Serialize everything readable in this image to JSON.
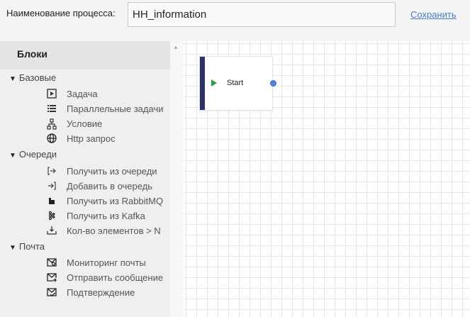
{
  "header": {
    "process_label": "Наименование процесса:",
    "process_name": "HH_information",
    "save_label": "Сохранить"
  },
  "sidebar": {
    "title": "Блоки",
    "groups": [
      {
        "label": "Базовые",
        "items": [
          {
            "label": "Задача",
            "icon": "play-box-icon"
          },
          {
            "label": "Параллельные задачи",
            "icon": "parallel-list-icon"
          },
          {
            "label": "Условие",
            "icon": "branch-icon"
          },
          {
            "label": "Http запрос",
            "icon": "globe-icon"
          }
        ]
      },
      {
        "label": "Очереди",
        "items": [
          {
            "label": "Получить из очереди",
            "icon": "arrow-out-icon"
          },
          {
            "label": "Добавить в очередь",
            "icon": "arrow-in-icon"
          },
          {
            "label": "Получить из RabbitMQ",
            "icon": "rabbitmq-icon"
          },
          {
            "label": "Получить из Kafka",
            "icon": "kafka-icon"
          },
          {
            "label": "Кол-во элементов > N",
            "icon": "count-tray-icon"
          }
        ]
      },
      {
        "label": "Почта",
        "items": [
          {
            "label": "Мониторинг почты",
            "icon": "mail-search-icon"
          },
          {
            "label": "Отправить сообщение",
            "icon": "mail-send-icon"
          },
          {
            "label": "Подтверждение",
            "icon": "mail-check-icon"
          }
        ]
      }
    ]
  },
  "canvas": {
    "nodes": [
      {
        "label": "Start"
      }
    ]
  },
  "colors": {
    "node_bar": "#2c3263",
    "start_play": "#2e9d4a",
    "port": "#4f86d8",
    "link": "#4a79c4"
  }
}
